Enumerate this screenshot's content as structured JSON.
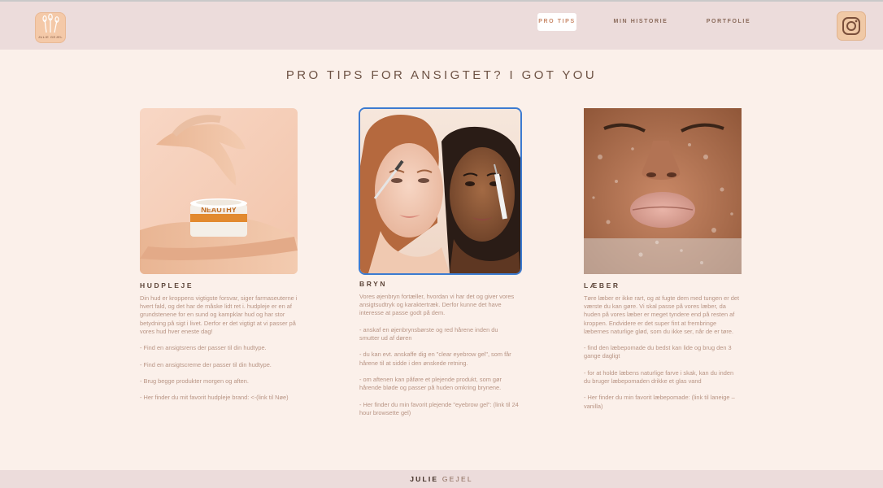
{
  "header": {
    "logo_text": "JULIE GEJEL",
    "nav": [
      {
        "label": "PRO TIPS",
        "active": true
      },
      {
        "label": "MIN HISTORIE",
        "active": false
      },
      {
        "label": "PORTFOLIE",
        "active": false
      }
    ],
    "instagram_icon": "instagram-icon"
  },
  "main": {
    "title": "PRO TIPS FOR ANSIGTET? I GOT YOU",
    "sections": [
      {
        "heading": "HUDPLEJE",
        "image": "hand-with-cream-jar-photo",
        "jar_brand": "NEAUTHY",
        "body": "Din hud er kroppens vigtigste forsvar, siger farmaseuterne i hvert fald, og det har de måske lidt ret i. hudpleje er en af grundstenene for en sund og kampklar hud og har stor betydning på sigt i livet. Derfor er det vigtigt at vi passer på vores hud hver eneste dag!\n\n- Find en ansigtsrens der passer til din hudtype.\n\n- Find en ansigtscreme der passer til din hudtype.\n\n- Brug begge produkter morgen og aften.\n\n- Her finder du mit favorit hudpleje brand: <-(link til Nøe)"
      },
      {
        "heading": "BRYN",
        "image": "two-women-brow-gel-photo",
        "body": "Vores øjenbryn fortæller, hvordan vi har det og giver vores ansigtsudtryk og karaktertræk. Derfor kunne det have interesse at passe godt på dem.\n\n- anskaf en øjenbrynsbørste og red hårene inden du smutter ud af døren\n\n- du kan evt. anskaffe dig en \"clear eyebrow gel\", som får hårene til at sidde i den ønskede retning.\n\n- om aftenen kan påføre et plejende produkt, som gør hårende bløde og passer på huden omkring brynene.\n\n- Her finder du min favorit plejende \"eyebrow gel\": (link til 24 hour browsette gel)"
      },
      {
        "heading": "LÆBER",
        "image": "lips-behind-wet-glass-photo",
        "body": "Tøre læber er ikke rart, og at fugte dem med tungen er det værste du kan gøre. Vi skal passe på vores læber, da huden på vores læber er meget tyndere end på resten af kroppen. Endvidere er det super fint at frembringe læbernes naturlige glød, som du ikke ser, når de er tøre.\n\n- find den læbepomade du bedst kan lide og brug den 3 gange dagligt\n\n- for at holde læbens naturlige farve i skak, kan du inden du bruger læbepomaden drikke et glas vand\n\n- Her finder du min favorit læbepomade: (link til laneige – vanilla)"
      }
    ]
  },
  "footer": {
    "first": "JULIE",
    "last": "GEJEL"
  },
  "colors": {
    "background": "#fbf0ea",
    "bars": "#ecdcdb",
    "selected_border": "#3c7bd1"
  }
}
